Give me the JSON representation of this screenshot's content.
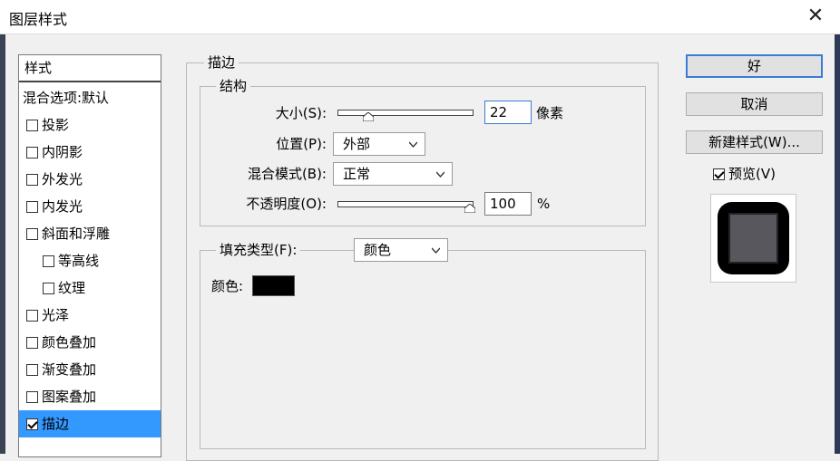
{
  "window": {
    "title": "图层样式",
    "close_glyph": "✕"
  },
  "style_list": {
    "header": "样式",
    "blend_default": "混合选项:默认",
    "items": [
      {
        "label": "投影",
        "checked": false,
        "sub": false
      },
      {
        "label": "内阴影",
        "checked": false,
        "sub": false
      },
      {
        "label": "外发光",
        "checked": false,
        "sub": false
      },
      {
        "label": "内发光",
        "checked": false,
        "sub": false
      },
      {
        "label": "斜面和浮雕",
        "checked": false,
        "sub": false
      },
      {
        "label": "等高线",
        "checked": false,
        "sub": true
      },
      {
        "label": "纹理",
        "checked": false,
        "sub": true
      },
      {
        "label": "光泽",
        "checked": false,
        "sub": false
      },
      {
        "label": "颜色叠加",
        "checked": false,
        "sub": false
      },
      {
        "label": "渐变叠加",
        "checked": false,
        "sub": false
      },
      {
        "label": "图案叠加",
        "checked": false,
        "sub": false
      },
      {
        "label": "描边",
        "checked": true,
        "sub": false,
        "selected": true
      }
    ]
  },
  "stroke": {
    "section_title": "描边",
    "structure_title": "结构",
    "size_label": "大小(S):",
    "size_value": "22",
    "size_unit": "像素",
    "size_slider_fraction": 0.13,
    "position_label": "位置(P):",
    "position_value": "外部",
    "blend_label": "混合模式(B):",
    "blend_value": "正常",
    "opacity_label": "不透明度(O):",
    "opacity_value": "100",
    "opacity_unit": "%",
    "opacity_slider_fraction": 1.0,
    "fill_type_label": "填充类型(F):",
    "fill_type_value": "颜色",
    "color_label": "颜色:",
    "color_swatch": "#000000"
  },
  "buttons": {
    "ok": "好",
    "cancel": "取消",
    "new_style": "新建样式(W)...",
    "preview": "预览(V)",
    "preview_checked": true
  },
  "colors": {
    "selection": "#3399ff",
    "focus_border": "#3a7bd5",
    "preview_fill": "#58575d"
  }
}
